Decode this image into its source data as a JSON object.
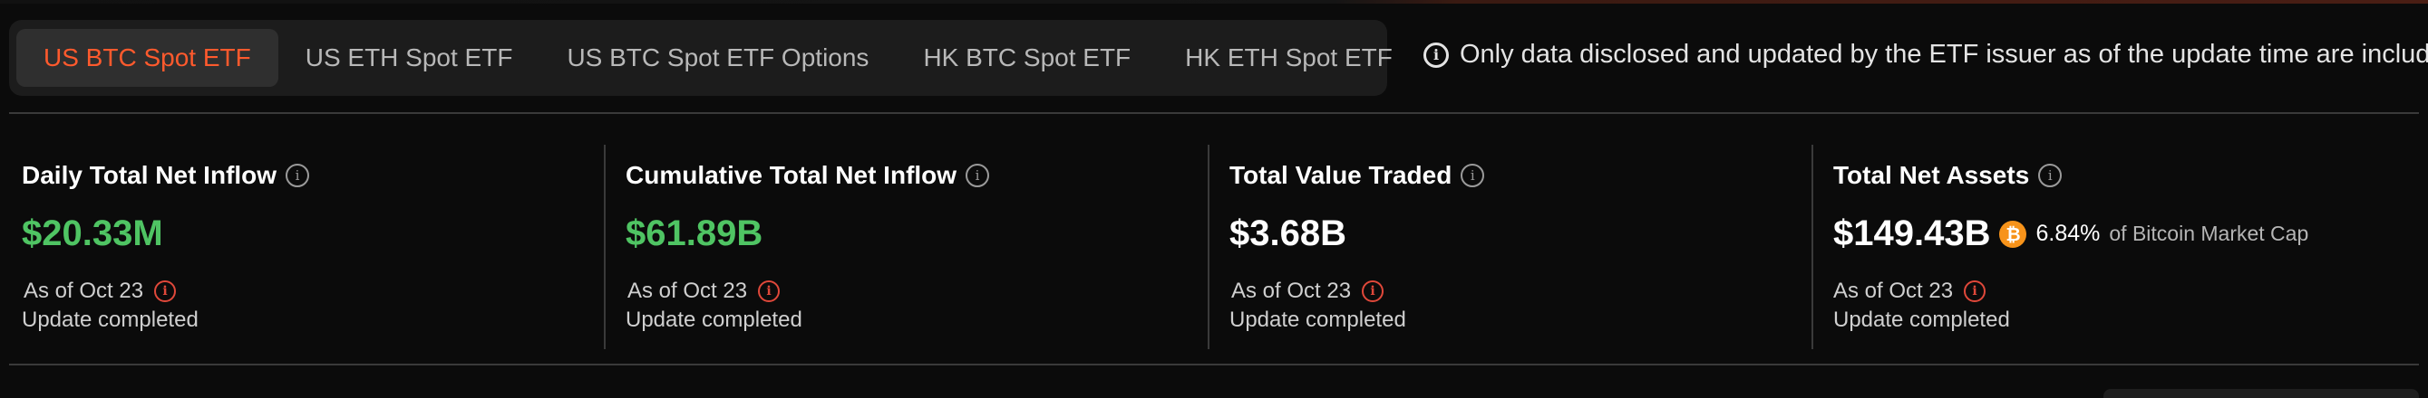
{
  "tabs": [
    {
      "label": "US BTC Spot ETF",
      "active": true
    },
    {
      "label": "US ETH Spot ETF",
      "active": false
    },
    {
      "label": "US BTC Spot ETF Options",
      "active": false
    },
    {
      "label": "HK BTC Spot ETF",
      "active": false
    },
    {
      "label": "HK ETH Spot ETF",
      "active": false
    }
  ],
  "notice": {
    "icon": "info-icon",
    "text": "Only data disclosed and updated by the ETF issuer as of the update time are included."
  },
  "stats": [
    {
      "title": "Daily Total Net Inflow",
      "value": "$20.33M",
      "value_color": "#4fc463",
      "as_of": "As of Oct 23",
      "status": "Update completed"
    },
    {
      "title": "Cumulative Total Net Inflow",
      "value": "$61.89B",
      "value_color": "#4fc463",
      "as_of": "As of Oct 23",
      "status": "Update completed"
    },
    {
      "title": "Total Value Traded",
      "value": "$3.68B",
      "value_color": "#ffffff",
      "as_of": "As of Oct 23",
      "status": "Update completed"
    },
    {
      "title": "Total Net Assets",
      "value": "$149.43B",
      "value_color": "#ffffff",
      "btc_icon": "bitcoin-icon",
      "btc_symbol": "₿",
      "market_cap_pct": "6.84%",
      "market_cap_suffix": "of Bitcoin Market Cap",
      "as_of": "As of Oct 23",
      "status": "Update completed"
    }
  ],
  "colors": {
    "accent": "#ff5a2d",
    "positive": "#4fc463",
    "warning": "#e0483a",
    "bitcoin": "#f7931a",
    "background": "#0b0b0b"
  }
}
